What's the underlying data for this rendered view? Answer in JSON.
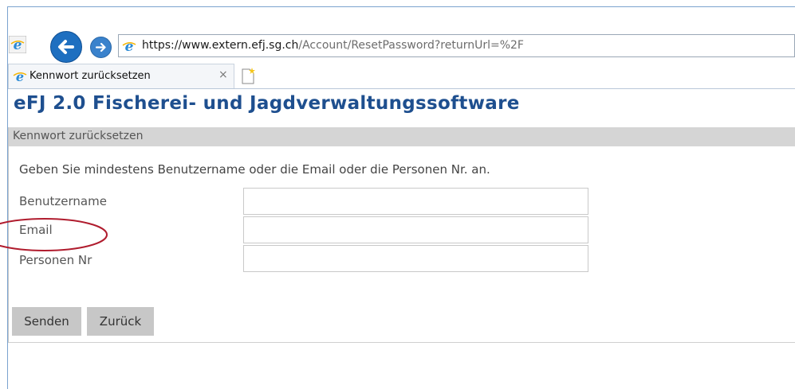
{
  "browser": {
    "url_host": "https://www.extern.efj.sg.ch",
    "url_path": "/Account/ResetPassword?returnUrl=%2F",
    "tab_title": "Kennwort zurücksetzen",
    "tab_close": "×"
  },
  "app": {
    "title": "eFJ 2.0 Fischerei- und Jagdverwaltungssoftware"
  },
  "form": {
    "panel_title": "Kennwort zurücksetzen",
    "instruction": "Geben Sie mindestens Benutzername oder die Email oder die Personen Nr. an.",
    "fields": [
      {
        "label": "Benutzername",
        "value": ""
      },
      {
        "label": "Email",
        "value": ""
      },
      {
        "label": "Personen Nr",
        "value": ""
      }
    ],
    "buttons": {
      "send": "Senden",
      "back": "Zurück"
    }
  },
  "colors": {
    "title_blue": "#1e4f8f",
    "panel_header": "#d5d5d5",
    "button_gray": "#c7c7c7",
    "annotation_red": "#b01c2e"
  }
}
